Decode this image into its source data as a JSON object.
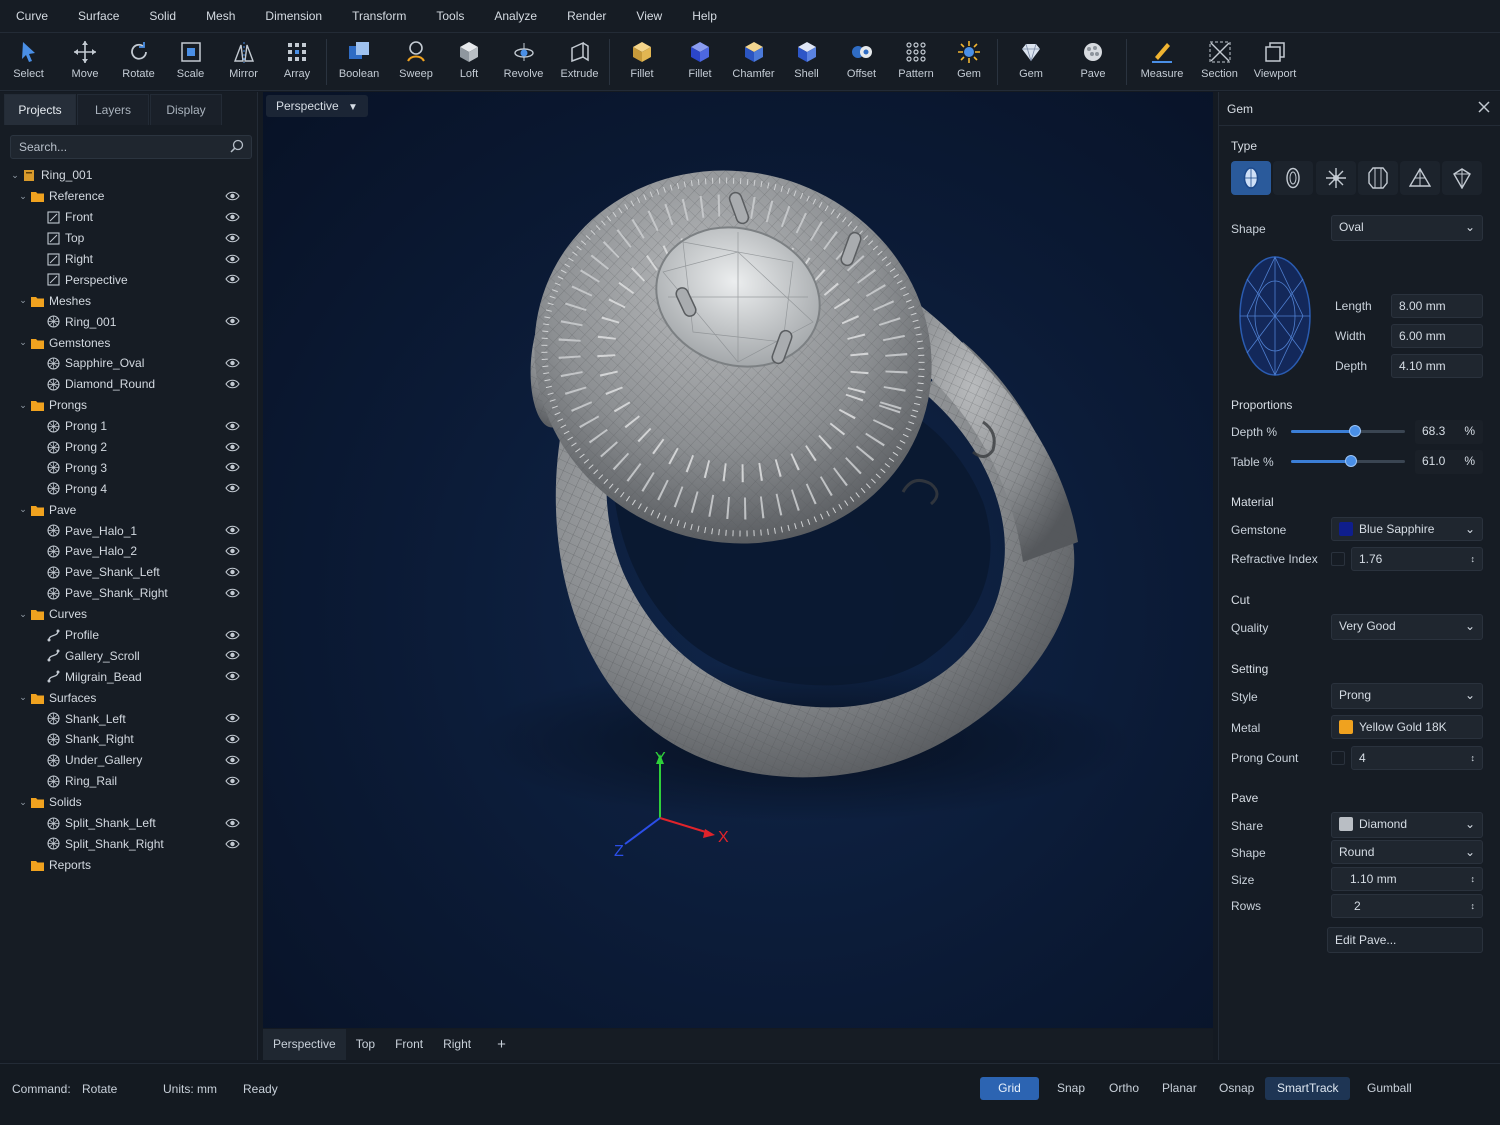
{
  "menu": [
    "Curve",
    "Surface",
    "Solid",
    "Mesh",
    "Dimension",
    "Transform",
    "Tools",
    "Analyze",
    "Render",
    "View",
    "Help"
  ],
  "toolbar": [
    {
      "label": "Select",
      "icon": "cursor-icon"
    },
    {
      "label": "Move",
      "icon": "move-icon"
    },
    {
      "label": "Rotate",
      "icon": "rotate-icon"
    },
    {
      "label": "Scale",
      "icon": "scale-icon"
    },
    {
      "label": "Mirror",
      "icon": "mirror-icon"
    },
    {
      "label": "Array",
      "icon": "array-icon"
    },
    {
      "label": "Boolean",
      "icon": "boolean-icon"
    },
    {
      "label": "Sweep",
      "icon": "sweep-icon"
    },
    {
      "label": "Loft",
      "icon": "loft-icon"
    },
    {
      "label": "Revolve",
      "icon": "revolve-icon"
    },
    {
      "label": "Extrude",
      "icon": "extrude-icon"
    },
    {
      "label": "Fillet",
      "icon": "fillet-icon"
    },
    {
      "label": "Fillet",
      "icon": "fillet-solid-icon"
    },
    {
      "label": "Chamfer",
      "icon": "chamfer-icon"
    },
    {
      "label": "Shell",
      "icon": "shell-icon"
    },
    {
      "label": "Offset",
      "icon": "offset-icon"
    },
    {
      "label": "Pattern",
      "icon": "pattern-icon"
    },
    {
      "label": "Gem",
      "icon": "gem-sparkle-icon"
    },
    {
      "label": "Gem",
      "icon": "gem-icon"
    },
    {
      "label": "Pave",
      "icon": "pave-icon"
    },
    {
      "label": "Measure",
      "icon": "measure-icon"
    },
    {
      "label": "Section",
      "icon": "section-icon"
    },
    {
      "label": "Viewport",
      "icon": "viewport-icon"
    }
  ],
  "left_tabs": [
    "Projects",
    "Layers",
    "Display"
  ],
  "search": {
    "placeholder": "Search..."
  },
  "tree": [
    {
      "label": "Ring_001",
      "level": 0,
      "icon": "file-icon",
      "caret": true,
      "eye": false
    },
    {
      "label": "Reference",
      "level": 1,
      "icon": "folder-icon",
      "caret": true,
      "eye": true
    },
    {
      "label": "Front",
      "level": 2,
      "icon": "view-icon",
      "eye": true
    },
    {
      "label": "Top",
      "level": 2,
      "icon": "view-icon",
      "eye": true
    },
    {
      "label": "Right",
      "level": 2,
      "icon": "view-icon",
      "eye": true
    },
    {
      "label": "Perspective",
      "level": 2,
      "icon": "view-icon",
      "eye": true
    },
    {
      "label": "Meshes",
      "level": 1,
      "icon": "folder-icon",
      "caret": true,
      "eye": false
    },
    {
      "label": "Ring_001",
      "level": 2,
      "icon": "mesh-icon",
      "eye": true
    },
    {
      "label": "Gemstones",
      "level": 1,
      "icon": "folder-icon",
      "caret": true,
      "eye": false
    },
    {
      "label": "Sapphire_Oval",
      "level": 2,
      "icon": "mesh-icon",
      "eye": true
    },
    {
      "label": "Diamond_Round",
      "level": 2,
      "icon": "mesh-icon",
      "eye": true
    },
    {
      "label": "Prongs",
      "level": 1,
      "icon": "folder-icon",
      "caret": true,
      "eye": false
    },
    {
      "label": "Prong 1",
      "level": 2,
      "icon": "mesh-icon",
      "eye": true
    },
    {
      "label": "Prong 2",
      "level": 2,
      "icon": "mesh-icon",
      "eye": true
    },
    {
      "label": "Prong 3",
      "level": 2,
      "icon": "mesh-icon",
      "eye": true
    },
    {
      "label": "Prong 4",
      "level": 2,
      "icon": "mesh-icon",
      "eye": true
    },
    {
      "label": "Pave",
      "level": 1,
      "icon": "folder-icon",
      "caret": true,
      "eye": false
    },
    {
      "label": "Pave_Halo_1",
      "level": 2,
      "icon": "mesh-icon",
      "eye": true
    },
    {
      "label": "Pave_Halo_2",
      "level": 2,
      "icon": "mesh-icon",
      "eye": true
    },
    {
      "label": "Pave_Shank_Left",
      "level": 2,
      "icon": "mesh-icon",
      "eye": true
    },
    {
      "label": "Pave_Shank_Right",
      "level": 2,
      "icon": "mesh-icon",
      "eye": true
    },
    {
      "label": "Curves",
      "level": 1,
      "icon": "folder-icon",
      "caret": true,
      "eye": false
    },
    {
      "label": "Profile",
      "level": 2,
      "icon": "curve-icon",
      "eye": true
    },
    {
      "label": "Gallery_Scroll",
      "level": 2,
      "icon": "curve-icon",
      "eye": true
    },
    {
      "label": "Milgrain_Bead",
      "level": 2,
      "icon": "curve-icon",
      "eye": true
    },
    {
      "label": "Surfaces",
      "level": 1,
      "icon": "folder-icon",
      "caret": true,
      "eye": false
    },
    {
      "label": "Shank_Left",
      "level": 2,
      "icon": "mesh-icon",
      "eye": true
    },
    {
      "label": "Shank_Right",
      "level": 2,
      "icon": "mesh-icon",
      "eye": true
    },
    {
      "label": "Under_Gallery",
      "level": 2,
      "icon": "mesh-icon",
      "eye": true
    },
    {
      "label": "Ring_Rail",
      "level": 2,
      "icon": "mesh-icon",
      "eye": true
    },
    {
      "label": "Solids",
      "level": 1,
      "icon": "folder-icon",
      "caret": true,
      "eye": false
    },
    {
      "label": "Split_Shank_Left",
      "level": 2,
      "icon": "mesh-icon",
      "eye": true
    },
    {
      "label": "Split_Shank_Right",
      "level": 2,
      "icon": "mesh-icon",
      "eye": true
    },
    {
      "label": "Reports",
      "level": 1,
      "icon": "folder-icon",
      "caret": false,
      "eye": false
    }
  ],
  "viewport": {
    "label": "Perspective",
    "axis": {
      "x": "X",
      "y": "Y",
      "z": "Z"
    }
  },
  "view_tabs": [
    "Perspective",
    "Top",
    "Front",
    "Right",
    "+"
  ],
  "gem_panel": {
    "title": "Gem",
    "type_label": "Type",
    "shape_label": "Shape",
    "shape": "Oval",
    "length_label": "Length",
    "length": "8.00 mm",
    "width_label": "Width",
    "width": "6.00 mm",
    "depth_label": "Depth",
    "depth": "4.10 mm",
    "proportions_label": "Proportions",
    "depth_pct_label": "Depth %",
    "depth_pct": "68.3",
    "depth_pct_value": 0.56,
    "table_pct_label": "Table %",
    "table_pct": "61.0",
    "table_pct_value": 0.53,
    "pct_unit": "%",
    "material_label": "Material",
    "gemstone_label": "Gemstone",
    "gemstone": "Blue Sapphire",
    "gemstone_color": "#0f1e8c",
    "ri_label": "Refractive Index",
    "ri": "1.76",
    "cut_label": "Cut",
    "quality_label": "Quality",
    "quality": "Very Good",
    "setting_label": "Setting",
    "style_label": "Style",
    "style": "Prong",
    "metal_label": "Metal",
    "metal": "Yellow Gold 18K",
    "metal_color": "#f0a21f",
    "prong_count_label": "Prong Count",
    "prong_count": "4",
    "pave_label": "Pave",
    "share_label": "Share",
    "share": "Diamond",
    "share_color": "#b9bec4",
    "pave_shape_label": "Shape",
    "pave_shape": "Round",
    "size_label": "Size",
    "size": "1.10 mm",
    "rows_label": "Rows",
    "rows": "2",
    "edit_pave": "Edit Pave..."
  },
  "status": {
    "command_label": "Command:",
    "command": "Rotate",
    "units": "Units: mm",
    "state": "Ready"
  },
  "toggles": [
    {
      "label": "Grid",
      "on": true
    },
    {
      "label": "Snap",
      "on": false
    },
    {
      "label": "Ortho",
      "on": false
    },
    {
      "label": "Planar",
      "on": false
    },
    {
      "label": "Osnap",
      "on": false
    },
    {
      "label": "SmartTrack",
      "on": true
    },
    {
      "label": "Gumball",
      "on": false
    }
  ],
  "colors": {
    "accent": "#2c64b2",
    "folder": "#f0a21f"
  }
}
